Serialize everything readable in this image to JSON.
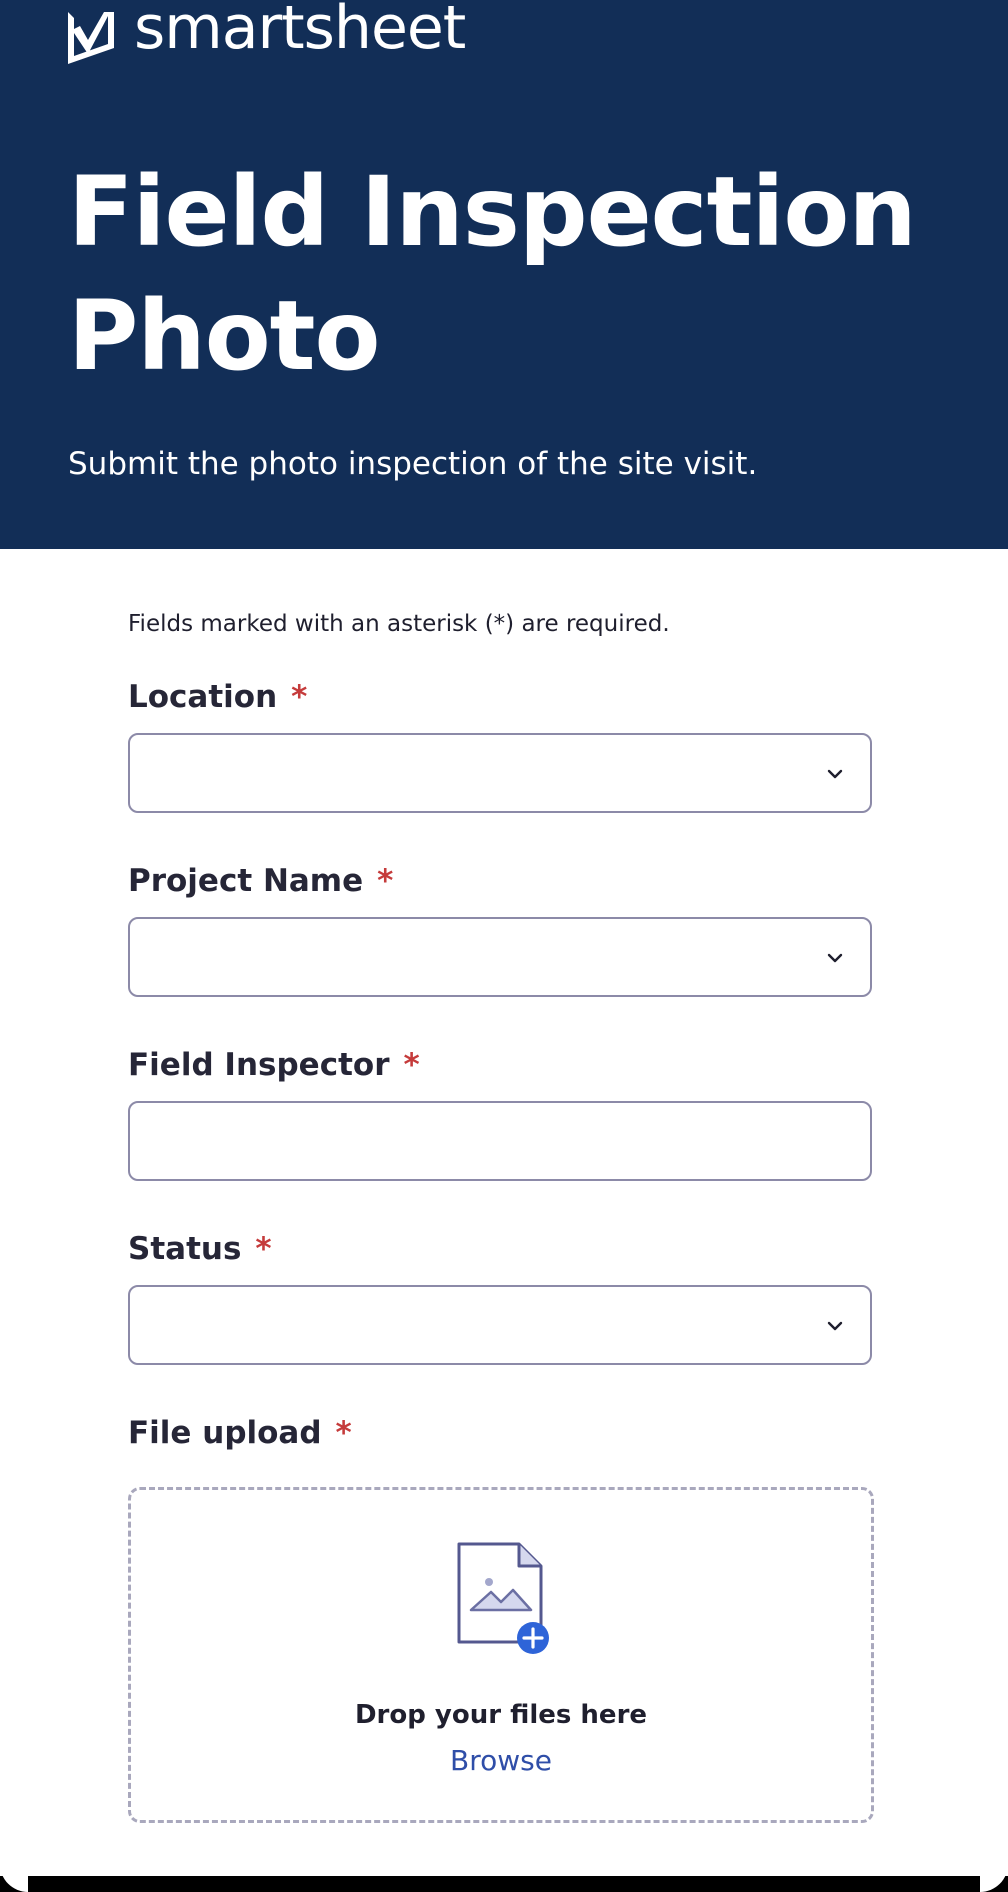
{
  "app": {
    "logo_text": "smartsheet"
  },
  "header": {
    "title": "Field Inspection Photo",
    "subtitle": "Submit the photo inspection of the site visit."
  },
  "form": {
    "required_note": "Fields marked with an asterisk (*) are required.",
    "required_marker": "*",
    "fields": [
      {
        "label": "Location",
        "type": "dropdown",
        "value": ""
      },
      {
        "label": "Project Name",
        "type": "dropdown",
        "value": ""
      },
      {
        "label": "Field Inspector",
        "type": "text",
        "value": ""
      },
      {
        "label": "Status",
        "type": "dropdown",
        "value": ""
      }
    ],
    "upload": {
      "label": "File upload",
      "drop_text": "Drop your files here",
      "browse_label": "Browse",
      "icon": "image-file-add-icon"
    }
  },
  "colors": {
    "header_bg": "#122e57",
    "required": "#c53b3b",
    "link": "#2f4ea8",
    "border": "#8c8aa8",
    "icon_accent": "#2e64d8"
  }
}
